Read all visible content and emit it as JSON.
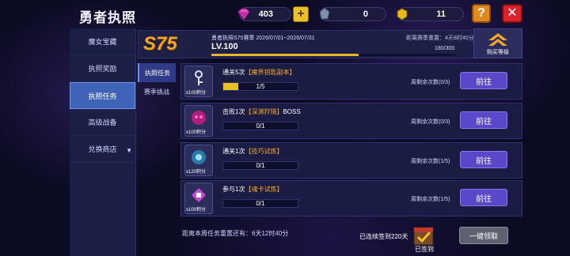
{
  "header": {
    "title": "勇者执照"
  },
  "resources": {
    "gems": "403",
    "crystals": "0",
    "coins": "11"
  },
  "menu": [
    "魔女宝藏",
    "执照奖励",
    "执照任务",
    "高级战备",
    "兑换商店"
  ],
  "season": {
    "badge": "S75",
    "info": "勇者执照S75赛季 2026/07/01~2026/07/31",
    "level": "LV.100",
    "reset": "距离赛季重置：4天8时40分",
    "xp": "180/300",
    "xp_progress": 0.6,
    "buy_label": "购买等级"
  },
  "subtabs": [
    "执照任务",
    "赛季挑战"
  ],
  "tasks": [
    {
      "prefix": "通关5次",
      "highlight": "【魔界钥匙副本】",
      "suffix": "",
      "progress": "1/5",
      "ratio": 0.2,
      "points": "x100积分",
      "weekly": "周剩余次数(0/3)",
      "button": "前往"
    },
    {
      "prefix": "击败1次",
      "highlight": "【深渊狩猎】",
      "suffix": "BOSS",
      "progress": "0/1",
      "ratio": 0,
      "points": "x100积分",
      "weekly": "周剩余次数(0/3)",
      "button": "前往"
    },
    {
      "prefix": "通关1次",
      "highlight": "【技巧试炼】",
      "suffix": "",
      "progress": "0/1",
      "ratio": 0,
      "points": "x120积分",
      "weekly": "周剩余次数(1/5)",
      "button": "前往"
    },
    {
      "prefix": "参与1次",
      "highlight": "【魂卡试炼】",
      "suffix": "",
      "progress": "0/1",
      "ratio": 0,
      "points": "x100积分",
      "weekly": "周剩余次数(1/5)",
      "button": "前往"
    }
  ],
  "footer": {
    "reset_text": "距离本周任务重置还有：6天12时40分",
    "streak": "已连续签到220天",
    "signed": "已签到",
    "claim_all": "一键领取"
  }
}
